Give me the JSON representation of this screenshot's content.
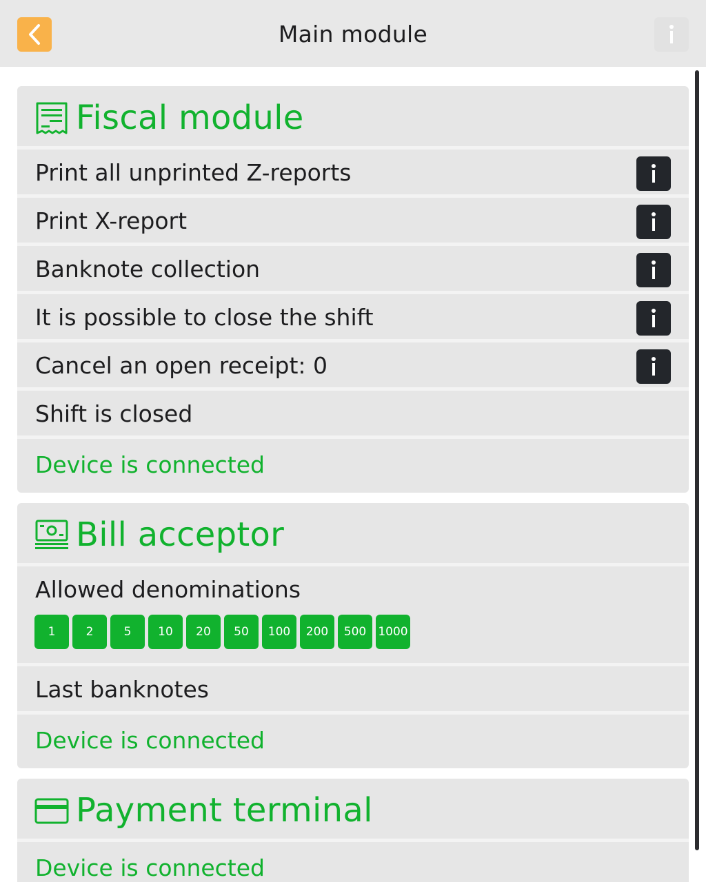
{
  "header": {
    "title": "Main module",
    "back_icon": "chevron-left-icon",
    "info_icon": "info-icon",
    "accent_color": "#f9b24a"
  },
  "colors": {
    "success": "#11b22e",
    "card_bg": "#e6e6e6",
    "info_button_bg": "#23262b"
  },
  "fiscal": {
    "title": "Fiscal module",
    "icon": "receipt-icon",
    "rows": [
      {
        "label": "Print all unprinted Z-reports",
        "has_info": true
      },
      {
        "label": "Print X-report",
        "has_info": true
      },
      {
        "label": "Banknote collection",
        "has_info": true
      },
      {
        "label": "It is possible to close the shift",
        "has_info": true
      },
      {
        "label": "Cancel an open receipt: 0",
        "has_info": true
      },
      {
        "label": "Shift is closed",
        "has_info": false
      }
    ],
    "status": "Device is connected"
  },
  "bill": {
    "title": "Bill acceptor",
    "icon": "banknote-icon",
    "denoms_label": "Allowed denominations",
    "denominations": [
      "1",
      "2",
      "5",
      "10",
      "20",
      "50",
      "100",
      "200",
      "500",
      "1000"
    ],
    "last_label": "Last banknotes",
    "status": "Device is connected"
  },
  "terminal": {
    "title": "Payment terminal",
    "icon": "credit-card-icon",
    "status": "Device is connected"
  }
}
